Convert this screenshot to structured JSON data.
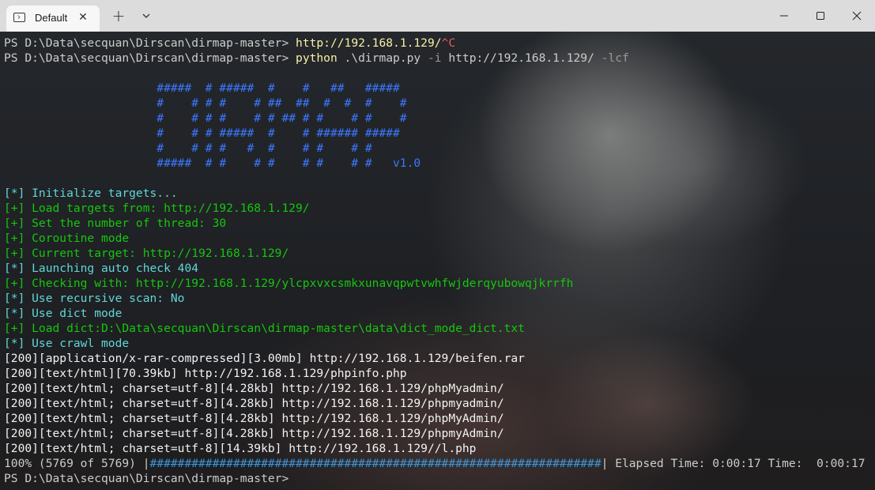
{
  "tab": {
    "title": "Default"
  },
  "icons": {
    "tab_icon": "terminal-icon",
    "close": "close-icon",
    "new_tab": "plus-icon",
    "dropdown": "chevron-down-icon",
    "minimize": "minimize-icon",
    "maximize": "maximize-icon",
    "window_close": "close-icon"
  },
  "colors": {
    "title_bar": "#dcdcdc",
    "tab_active": "#f7f7f7",
    "text": "#cccccc",
    "yellow": "#f9f1a5",
    "blue": "#3b78ff",
    "cyan": "#61d6d6",
    "green": "#16c60c"
  },
  "terminal": {
    "lines": [
      [
        {
          "t": "PS D:\\Data\\secquan\\Dirscan\\dirmap-master> ",
          "c": "white"
        },
        {
          "t": "http://192.168.1.129/",
          "c": "yellow"
        },
        {
          "t": "^C",
          "c": "red"
        }
      ],
      [
        {
          "t": "PS D:\\Data\\secquan\\Dirscan\\dirmap-master> ",
          "c": "white"
        },
        {
          "t": "python ",
          "c": "yellow"
        },
        {
          "t": ".\\dirmap.py ",
          "c": "white"
        },
        {
          "t": "-i ",
          "c": "gray"
        },
        {
          "t": "http://192.168.1.129/ ",
          "c": "white"
        },
        {
          "t": "-lcf",
          "c": "gray"
        }
      ],
      [
        {
          "t": "",
          "c": "white"
        }
      ],
      [
        {
          "t": "                      #####  # #####  #    #   ##   #####",
          "c": "blue"
        }
      ],
      [
        {
          "t": "                      #    # # #    # ##  ##  #  #  #    #",
          "c": "blue"
        }
      ],
      [
        {
          "t": "                      #    # # #    # # ## # #    # #    #",
          "c": "blue"
        }
      ],
      [
        {
          "t": "                      #    # # #####  #    # ###### #####",
          "c": "blue"
        }
      ],
      [
        {
          "t": "                      #    # # #   #  #    # #    # #",
          "c": "blue"
        }
      ],
      [
        {
          "t": "                      #####  # #    # #    # #    # #   v1.0",
          "c": "blue"
        }
      ],
      [
        {
          "t": "",
          "c": "white"
        }
      ],
      [
        {
          "t": "[*] Initialize targets...",
          "c": "cyan"
        }
      ],
      [
        {
          "t": "[+] Load targets from: http://192.168.1.129/",
          "c": "green"
        }
      ],
      [
        {
          "t": "[+] Set the number of thread: 30",
          "c": "green"
        }
      ],
      [
        {
          "t": "[+] Coroutine mode",
          "c": "green"
        }
      ],
      [
        {
          "t": "[+] Current target: http://192.168.1.129/",
          "c": "green"
        }
      ],
      [
        {
          "t": "[*] Launching auto check 404",
          "c": "cyan"
        }
      ],
      [
        {
          "t": "[+] Checking with: http://192.168.1.129/ylcpxvxcsmkxunavqpwtvwhfwjderqyubowqjkrrfh",
          "c": "green"
        }
      ],
      [
        {
          "t": "[*] Use recursive scan: No",
          "c": "cyan"
        }
      ],
      [
        {
          "t": "[*] Use dict mode",
          "c": "cyan"
        }
      ],
      [
        {
          "t": "[+] Load dict:D:\\Data\\secquan\\Dirscan\\dirmap-master\\data\\dict_mode_dict.txt",
          "c": "green"
        }
      ],
      [
        {
          "t": "[*] Use crawl mode",
          "c": "cyan"
        }
      ],
      [
        {
          "t": "[200][application/x-rar-compressed][3.00mb] http://192.168.1.129/beifen.rar",
          "c": "bright"
        }
      ],
      [
        {
          "t": "[200][text/html][70.39kb] http://192.168.1.129/phpinfo.php",
          "c": "bright"
        }
      ],
      [
        {
          "t": "[200][text/html; charset=utf-8][4.28kb] http://192.168.1.129/phpMyadmin/",
          "c": "bright"
        }
      ],
      [
        {
          "t": "[200][text/html; charset=utf-8][4.28kb] http://192.168.1.129/phpmyadmin/",
          "c": "bright"
        }
      ],
      [
        {
          "t": "[200][text/html; charset=utf-8][4.28kb] http://192.168.1.129/phpMyAdmin/",
          "c": "bright"
        }
      ],
      [
        {
          "t": "[200][text/html; charset=utf-8][4.28kb] http://192.168.1.129/phpmyAdmin/",
          "c": "bright"
        }
      ],
      [
        {
          "t": "[200][text/html; charset=utf-8][14.39kb] http://192.168.1.129//l.php",
          "c": "bright"
        }
      ],
      [
        {
          "t": "100% (5769 of 5769) |",
          "c": "white"
        },
        {
          "t": "#################################################################",
          "c": "darkcyan"
        },
        {
          "t": "| Elapsed Time: 0:00:17 Time:  0:00:17",
          "c": "white"
        }
      ],
      [
        {
          "t": "PS D:\\Data\\secquan\\Dirscan\\dirmap-master>",
          "c": "white"
        }
      ]
    ]
  }
}
